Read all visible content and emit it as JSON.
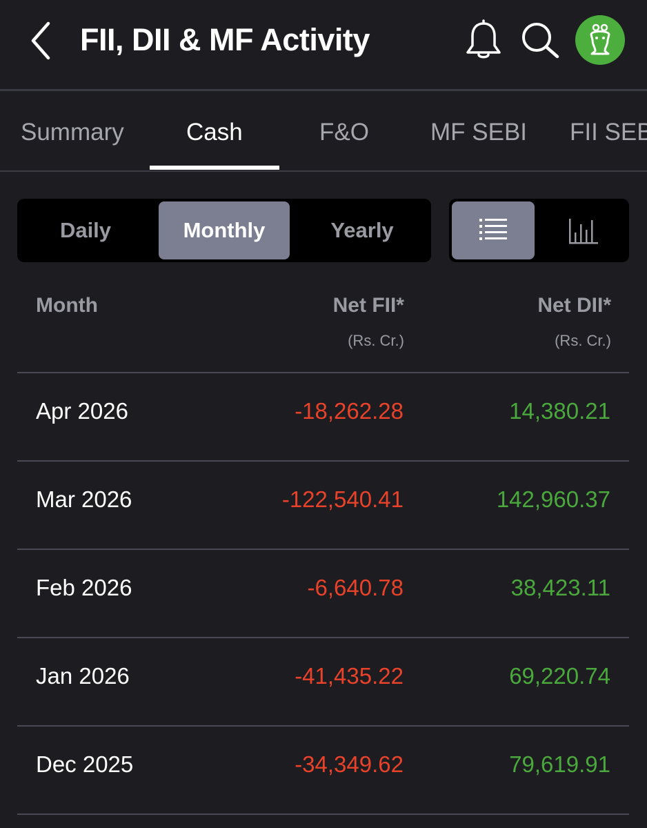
{
  "header": {
    "title": "FII, DII & MF Activity",
    "back_icon": "chevron-left-icon",
    "bell_icon": "bell-icon",
    "search_icon": "search-icon",
    "avatar_color": "#4cae3d"
  },
  "tabs": [
    {
      "label": "Summary",
      "active": false
    },
    {
      "label": "Cash",
      "active": true
    },
    {
      "label": "F&O",
      "active": false
    },
    {
      "label": "MF SEBI",
      "active": false
    },
    {
      "label": "FII SEBI",
      "active": false
    }
  ],
  "period_toggle": {
    "options": [
      "Daily",
      "Monthly",
      "Yearly"
    ],
    "selected": "Monthly"
  },
  "view_toggle": {
    "options": [
      "list-view-icon",
      "chart-view-icon"
    ],
    "selected": "list-view-icon"
  },
  "table": {
    "columns": [
      {
        "label": "Month",
        "unit": ""
      },
      {
        "label": "Net FII*",
        "unit": "(Rs. Cr.)"
      },
      {
        "label": "Net DII*",
        "unit": "(Rs. Cr.)"
      }
    ],
    "rows": [
      {
        "month": "Apr 2026",
        "net_fii": "-18,262.28",
        "net_dii": "14,380.21"
      },
      {
        "month": "Mar 2026",
        "net_fii": "-122,540.41",
        "net_dii": "142,960.37"
      },
      {
        "month": "Feb 2026",
        "net_fii": "-6,640.78",
        "net_dii": "38,423.11"
      },
      {
        "month": "Jan 2026",
        "net_fii": "-41,435.22",
        "net_dii": "69,220.74"
      },
      {
        "month": "Dec 2025",
        "net_fii": "-34,349.62",
        "net_dii": "79,619.91"
      }
    ]
  },
  "colors": {
    "background": "#1c1c21",
    "negative": "#e8432a",
    "positive": "#4aa83c",
    "muted": "#9a9aa2",
    "active_segment": "#7c7f91"
  }
}
